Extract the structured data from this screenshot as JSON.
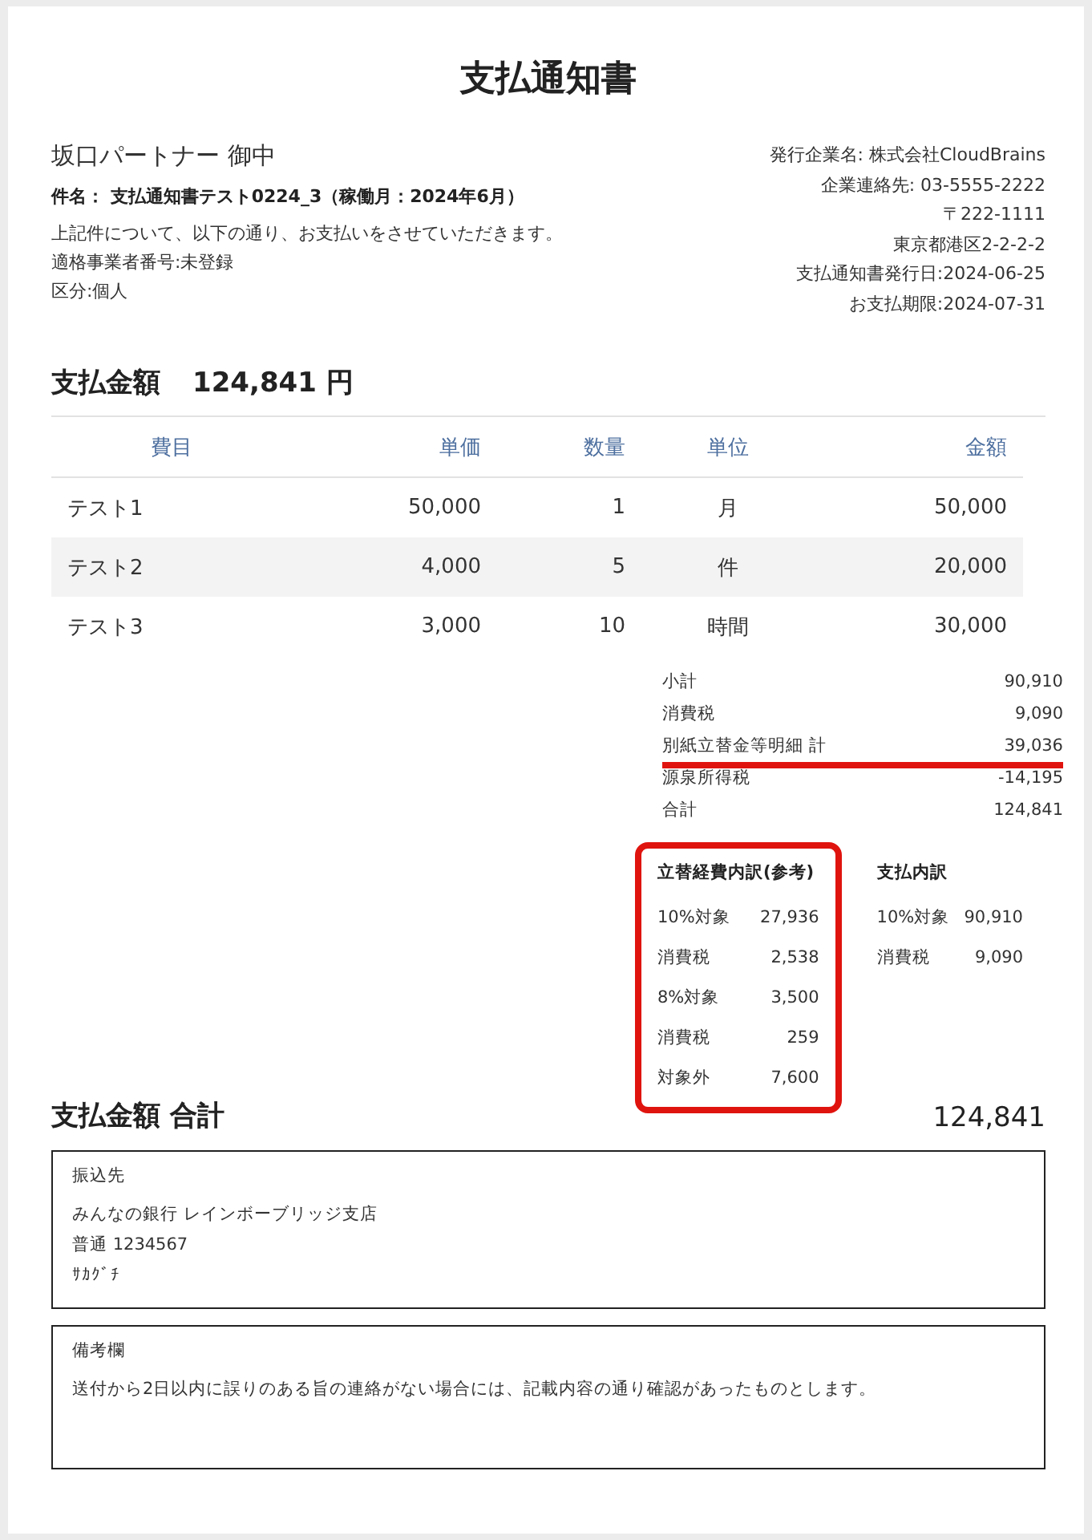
{
  "title": "支払通知書",
  "recipient": "坂口パートナー 御中",
  "subject": "件名： 支払通知書テスト0224_3（稼働月：2024年6月）",
  "intro_lines": [
    "上記件について、以下の通り、お支払いをさせていただきます。",
    "適格事業者番号:未登録",
    "区分:個人"
  ],
  "issuer_lines": [
    "発行企業名: 株式会社CloudBrains",
    "企業連絡先: 03-5555-2222",
    "〒222-1111",
    "東京都港区2-2-2-2",
    "支払通知書発行日:2024-06-25",
    "お支払期限:2024-07-31"
  ],
  "amount_label": "支払金額",
  "amount_value": "124,841 円",
  "table": {
    "columns": [
      "費目",
      "単価",
      "数量",
      "単位",
      "金額"
    ],
    "rows": [
      {
        "cells": [
          "テスト1",
          "50,000",
          "1",
          "月",
          "50,000"
        ]
      },
      {
        "cells": [
          "テスト2",
          "4,000",
          "5",
          "件",
          "20,000"
        ]
      },
      {
        "cells": [
          "テスト3",
          "3,000",
          "10",
          "時間",
          "30,000"
        ]
      }
    ]
  },
  "summary": [
    {
      "label": "小計",
      "value": "90,910",
      "highlighted": false
    },
    {
      "label": "消費税",
      "value": "9,090",
      "highlighted": false
    },
    {
      "label": "別紙立替金等明細 計",
      "value": "39,036",
      "highlighted": true
    },
    {
      "label": "源泉所得税",
      "value": "-14,195",
      "highlighted": false
    },
    {
      "label": "合計",
      "value": "124,841",
      "highlighted": false
    }
  ],
  "breakdowns": [
    {
      "title": "立替経費内訳(参考)",
      "highlighted": true,
      "rows": [
        {
          "label": "10%対象",
          "value": "27,936"
        },
        {
          "label": "消費税",
          "value": "2,538"
        },
        {
          "label": "8%対象",
          "value": "3,500"
        },
        {
          "label": "消費税",
          "value": "259"
        },
        {
          "label": "対象外",
          "value": "7,600"
        }
      ]
    },
    {
      "title": "支払内訳",
      "highlighted": false,
      "rows": [
        {
          "label": "10%対象",
          "value": "90,910"
        },
        {
          "label": "消費税",
          "value": "9,090"
        }
      ]
    }
  ],
  "total_label": "支払金額 合計",
  "total_value": "124,841",
  "boxes": [
    {
      "title": "振込先",
      "lines": [
        "みんなの銀行 レインボーブリッジ支店",
        "普通 1234567",
        "ｻｶｸﾞﾁ"
      ]
    },
    {
      "title": "備考欄",
      "lines": [
        "送付から2日以内に誤りのある旨の連絡がない場合には、記載内容の通り確認があったものとします。"
      ]
    }
  ]
}
